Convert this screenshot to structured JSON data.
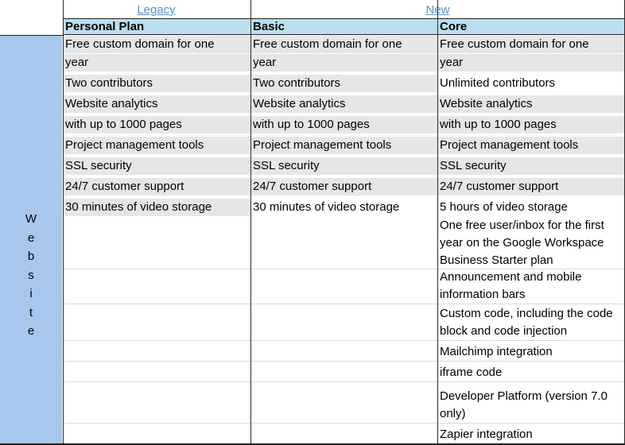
{
  "groups": {
    "legacy": "Legacy",
    "new": "New"
  },
  "headers": {
    "personal": "Personal Plan",
    "basic": "Basic",
    "core": "Core"
  },
  "row_label": [
    "W",
    "e",
    "b",
    "s",
    "i",
    "t",
    "e"
  ],
  "personal": [
    "Free custom domain for one",
    "year",
    "Two contributors",
    "Website analytics",
    "with up to 1000 pages",
    "Project management tools",
    "SSL security",
    "24/7 customer support",
    "30 minutes of video storage"
  ],
  "basic": [
    "Free custom domain for one",
    "year",
    "Two contributors",
    "Website analytics",
    "with up to 1000 pages",
    "Project management tools",
    "SSL security",
    "24/7 customer support",
    "30 minutes of video storage"
  ],
  "core": [
    "Free custom domain for one",
    "year",
    "Unlimited contributors",
    "Website analytics",
    "with up to 1000 pages",
    "Project management tools",
    "SSL security",
    "24/7 customer support",
    "5 hours of video storage",
    "One free user/inbox for the first",
    "year on the Google Workspace",
    "Business Starter plan",
    "Announcement and mobile",
    "information bars",
    "Custom code, including the code",
    "block and code injection",
    "Mailchimp integration",
    "iframe code",
    "Developer Platform (version 7.0",
    "only)",
    "Zapier integration"
  ],
  "colors": {
    "header_bg": "#bcdff0",
    "row_label_bg": "#a8c7ec",
    "gray_cell": "#e6e6e6",
    "group_link": "#5b8fc9"
  }
}
